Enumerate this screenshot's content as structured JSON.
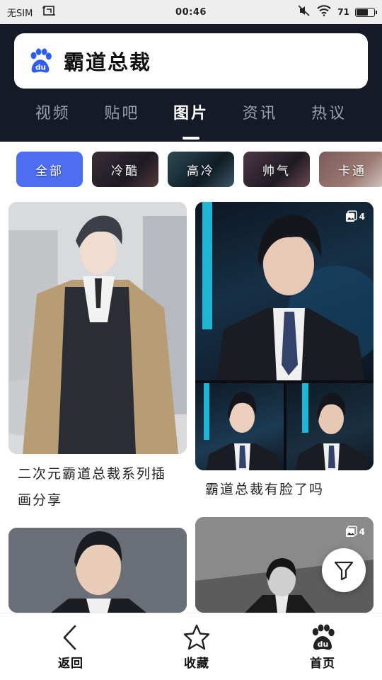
{
  "status_bar": {
    "carrier": "无SIM",
    "time": "00:46",
    "battery_text": "71",
    "battery_level_pct": 71
  },
  "search": {
    "query": "霸道总裁"
  },
  "tabs": [
    {
      "label": "视频"
    },
    {
      "label": "贴吧"
    },
    {
      "label": "图片",
      "active": true
    },
    {
      "label": "资讯"
    },
    {
      "label": "热议"
    }
  ],
  "chips": [
    {
      "label": "全部",
      "active": true
    },
    {
      "label": "冷酷"
    },
    {
      "label": "高冷"
    },
    {
      "label": "帅气"
    },
    {
      "label": "卡通"
    }
  ],
  "cards": [
    {
      "caption": "二次元霸道总裁系列插画分享"
    },
    {
      "caption": "霸道总裁有脸了吗",
      "image_count": "4"
    },
    {
      "caption": ""
    },
    {
      "caption": "",
      "image_count": "4"
    }
  ],
  "bottom_nav": {
    "back": "返回",
    "favorites": "收藏",
    "home": "首页"
  },
  "colors": {
    "header_bg": "#151a26",
    "accent": "#4e6ef2",
    "status_bg": "#eeeeee"
  },
  "icons": {
    "search_logo": "baidu-paw-icon",
    "filter": "filter-funnel-icon",
    "back": "chevron-left-icon",
    "favorites": "star-outline-icon",
    "home": "baidu-paw-icon",
    "multi_image": "gallery-stack-icon"
  }
}
